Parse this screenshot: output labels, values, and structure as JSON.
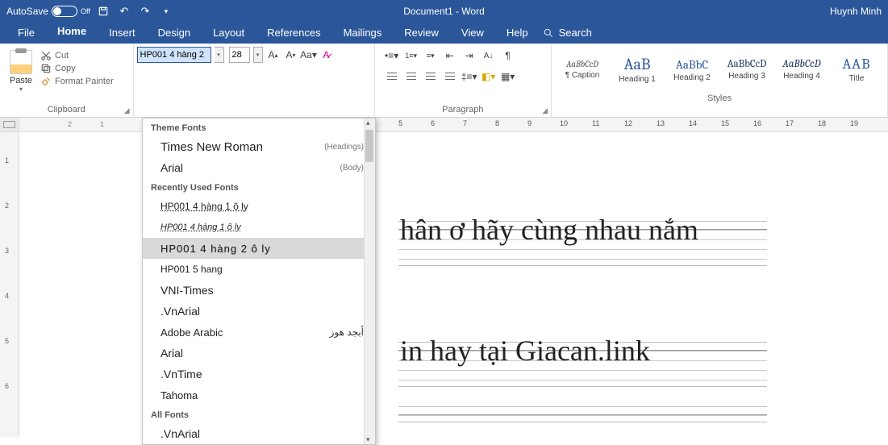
{
  "titlebar": {
    "autosave_label": "AutoSave",
    "autosave_state": "Off",
    "doc_title": "Document1  -  Word",
    "user": "Huynh Minh"
  },
  "tabs": {
    "file": "File",
    "home": "Home",
    "insert": "Insert",
    "design": "Design",
    "layout": "Layout",
    "references": "References",
    "mailings": "Mailings",
    "review": "Review",
    "view": "View",
    "help": "Help",
    "search": "Search"
  },
  "clipboard": {
    "paste": "Paste",
    "cut": "Cut",
    "copy": "Copy",
    "format_painter": "Format Painter",
    "group_label": "Clipboard"
  },
  "font": {
    "name_value": "HP001 4 hàng 2",
    "size_value": "28"
  },
  "paragraph": {
    "group_label": "Paragraph"
  },
  "styles": {
    "group_label": "Styles",
    "items": [
      {
        "preview": "AaBbCcD",
        "label": "¶ Caption",
        "cls": "caption"
      },
      {
        "preview": "AaB",
        "label": "Heading 1",
        "cls": "h1"
      },
      {
        "preview": "AaBbC",
        "label": "Heading 2",
        "cls": "h2"
      },
      {
        "preview": "AaBbCcD",
        "label": "Heading 3",
        "cls": "h3"
      },
      {
        "preview": "AaBbCcD",
        "label": "Heading 4",
        "cls": "h4"
      },
      {
        "preview": "AAB",
        "label": "Title",
        "cls": "title"
      }
    ]
  },
  "font_dropdown": {
    "theme_head": "Theme Fonts",
    "theme": [
      {
        "name": "Times New Roman",
        "hint": "(Headings)",
        "cls": "f-times"
      },
      {
        "name": "Arial",
        "hint": "(Body)",
        "cls": "f-arial"
      }
    ],
    "recent_head": "Recently Used Fonts",
    "recent": [
      {
        "name": "HP001 4 hàng 1 ô ly",
        "cls": "f-script"
      },
      {
        "name": "HP001 4 hàng 1 ô ly",
        "cls": "f-script2"
      },
      {
        "name": "HP001 4 hàng 2 ô ly",
        "cls": "f-script3",
        "hover": true
      },
      {
        "name": "HP001 5 hang",
        "cls": "f-scriptsm"
      },
      {
        "name": "VNI-Times",
        "cls": "f-vnitimes"
      },
      {
        "name": ".VnArial",
        "cls": "f-vnarial"
      },
      {
        "name": "Adobe Arabic",
        "cls": "f-adobe",
        "rtl": "أبجد هوز"
      },
      {
        "name": "Arial",
        "cls": "f-arial"
      },
      {
        "name": ".VnTime",
        "cls": "f-vntime"
      },
      {
        "name": "Tahoma",
        "cls": "f-tahoma"
      }
    ],
    "all_head": "All Fonts",
    "all": [
      {
        "name": ".VnArial",
        "cls": "f-vnarial"
      }
    ]
  },
  "ruler_numbers": [
    "5",
    "6",
    "7",
    "8",
    "9",
    "10",
    "11",
    "12",
    "13",
    "14",
    "15",
    "16",
    "17",
    "18",
    "19"
  ],
  "ruler_left": [
    "1",
    "2"
  ],
  "vruler_numbers": [
    "1",
    "2",
    "3",
    "4",
    "5",
    "6"
  ],
  "doc": {
    "line1": "hân ơ hãy cùng nhau nắm",
    "line2": "in hay tại Giacan.link"
  }
}
